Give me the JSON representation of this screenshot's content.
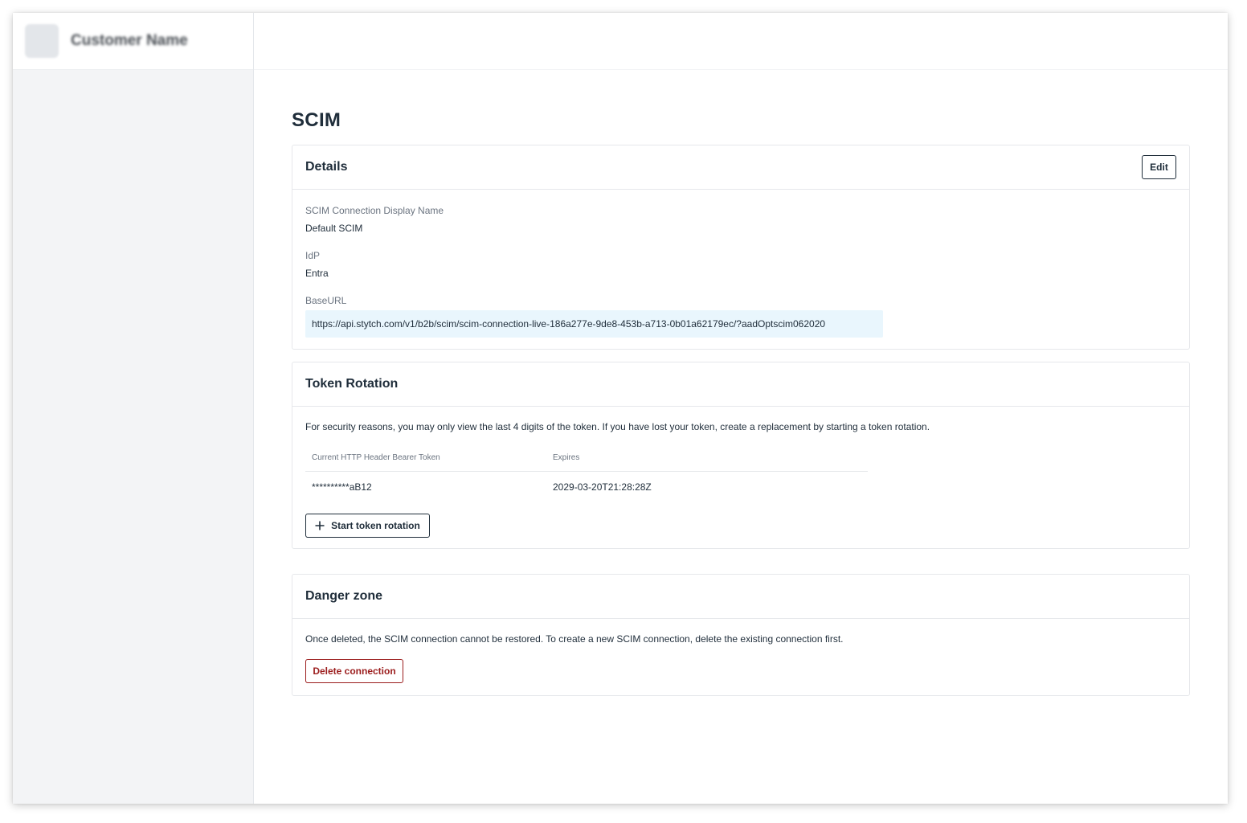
{
  "sidebar": {
    "customer_name": "Customer Name"
  },
  "page": {
    "title": "SCIM"
  },
  "details": {
    "title": "Details",
    "edit_label": "Edit",
    "fields": {
      "display_name_label": "SCIM Connection Display Name",
      "display_name_value": "Default SCIM",
      "idp_label": "IdP",
      "idp_value": "Entra",
      "base_url_label": "BaseURL",
      "base_url_value": "https://api.stytch.com/v1/b2b/scim/scim-connection-live-186a277e-9de8-453b-a713-0b01a62179ec/?aadOptscim062020"
    }
  },
  "token_rotation": {
    "title": "Token Rotation",
    "description": "For security reasons, you may only view the last 4 digits of the token. If you have lost your token, create a replacement by starting a token rotation.",
    "columns": [
      "Current HTTP Header Bearer Token",
      "Expires"
    ],
    "rows": [
      {
        "token": "**********aB12",
        "expires": "2029-03-20T21:28:28Z"
      }
    ],
    "start_label": "Start token rotation",
    "start_icon": "plus-icon"
  },
  "danger_zone": {
    "title": "Danger zone",
    "description": "Once deleted, the SCIM connection cannot be restored. To create a new SCIM connection, delete the existing connection first.",
    "delete_label": "Delete connection"
  },
  "colors": {
    "url_background": "#e9f6fd",
    "danger": "#9b1c1c",
    "sidebar_background": "#f3f4f6"
  }
}
